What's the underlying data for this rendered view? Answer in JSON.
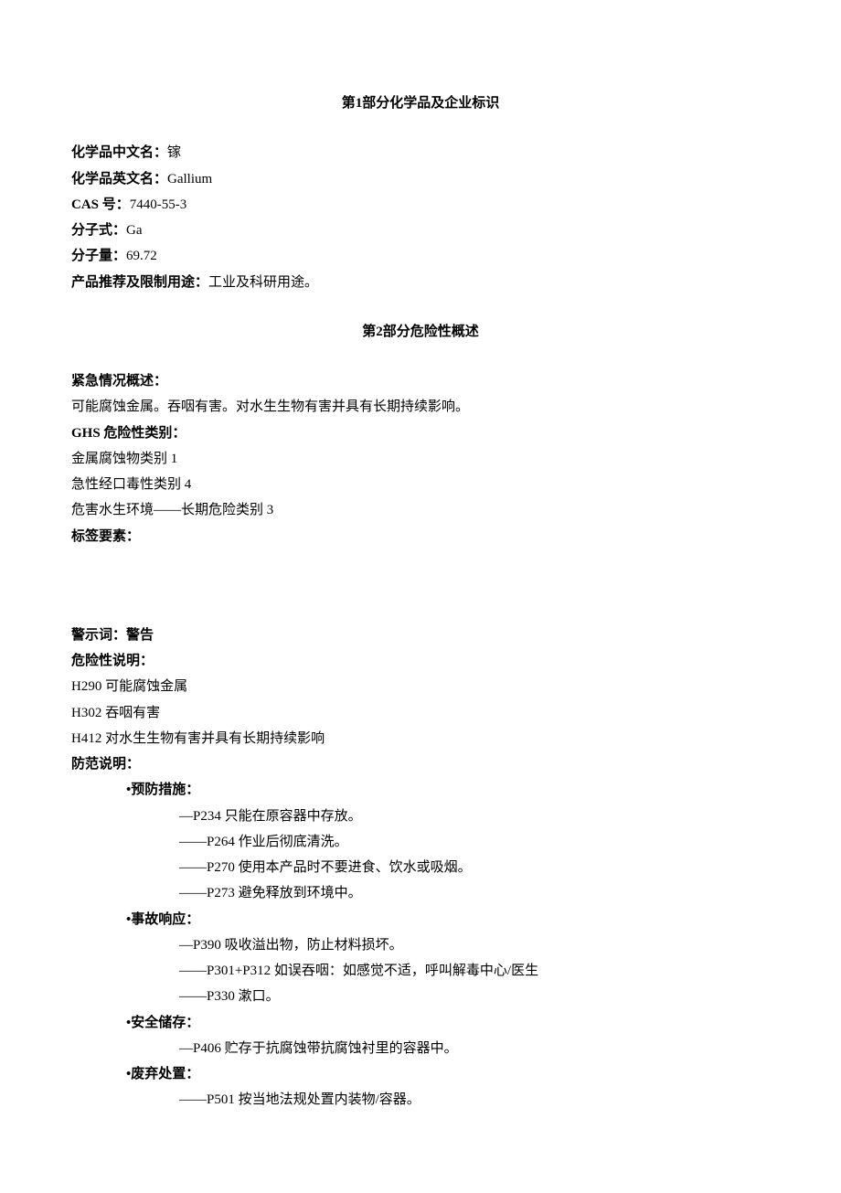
{
  "section1": {
    "title_prefix": "第",
    "title_num": "1",
    "title_suffix": "部分化学品及企业标识",
    "rows": {
      "name_cn_label": "化学品中文名：",
      "name_cn_value": "镓",
      "name_en_label": "化学品英文名：",
      "name_en_value": "Gallium",
      "cas_label": "CAS 号：",
      "cas_value": "7440-55-3",
      "formula_label": "分子式：",
      "formula_value": "Ga",
      "mw_label": "分子量：",
      "mw_value": "69.72",
      "use_label": "产品推荐及限制用途：",
      "use_value": "工业及科研用途。"
    }
  },
  "section2": {
    "title_prefix": "第",
    "title_num": "2",
    "title_suffix": "部分危险性概述",
    "emergency_label": "紧急情况概述：",
    "emergency_text": "可能腐蚀金属。吞咽有害。对水生生物有害并具有长期持续影响。",
    "ghs_label": "GHS 危险性类别：",
    "ghs_items": [
      "金属腐蚀物类别 1",
      "急性经口毒性类别 4",
      "危害水生环境——长期危险类别 3"
    ],
    "label_elements": "标签要素：",
    "signal_label": "警示词：",
    "signal_value": "警告",
    "hazard_label": "危险性说明：",
    "hazard_items": [
      "H290 可能腐蚀金属",
      "H302 吞咽有害",
      "H412 对水生生物有害并具有长期持续影响"
    ],
    "precaution_label": "防范说明：",
    "precaution_groups": [
      {
        "title": "预防措施：",
        "items": [
          "—P234 只能在原容器中存放。",
          "——P264 作业后彻底清洗。",
          "——P270 使用本产品时不要进食、饮水或吸烟。",
          "——P273 避免释放到环境中。"
        ]
      },
      {
        "title": "事故响应：",
        "items": [
          "—P390 吸收溢出物，防止材料损坏。",
          "——P301+P312 如误吞咽：如感觉不适，呼叫解毒中心/医生",
          "——P330 漱口。"
        ]
      },
      {
        "title": "安全储存：",
        "items": [
          "—P406 贮存于抗腐蚀带抗腐蚀衬里的容器中。"
        ]
      },
      {
        "title": "废弃处置：",
        "items": [
          "——P501 按当地法规处置内装物/容器。"
        ]
      }
    ]
  }
}
